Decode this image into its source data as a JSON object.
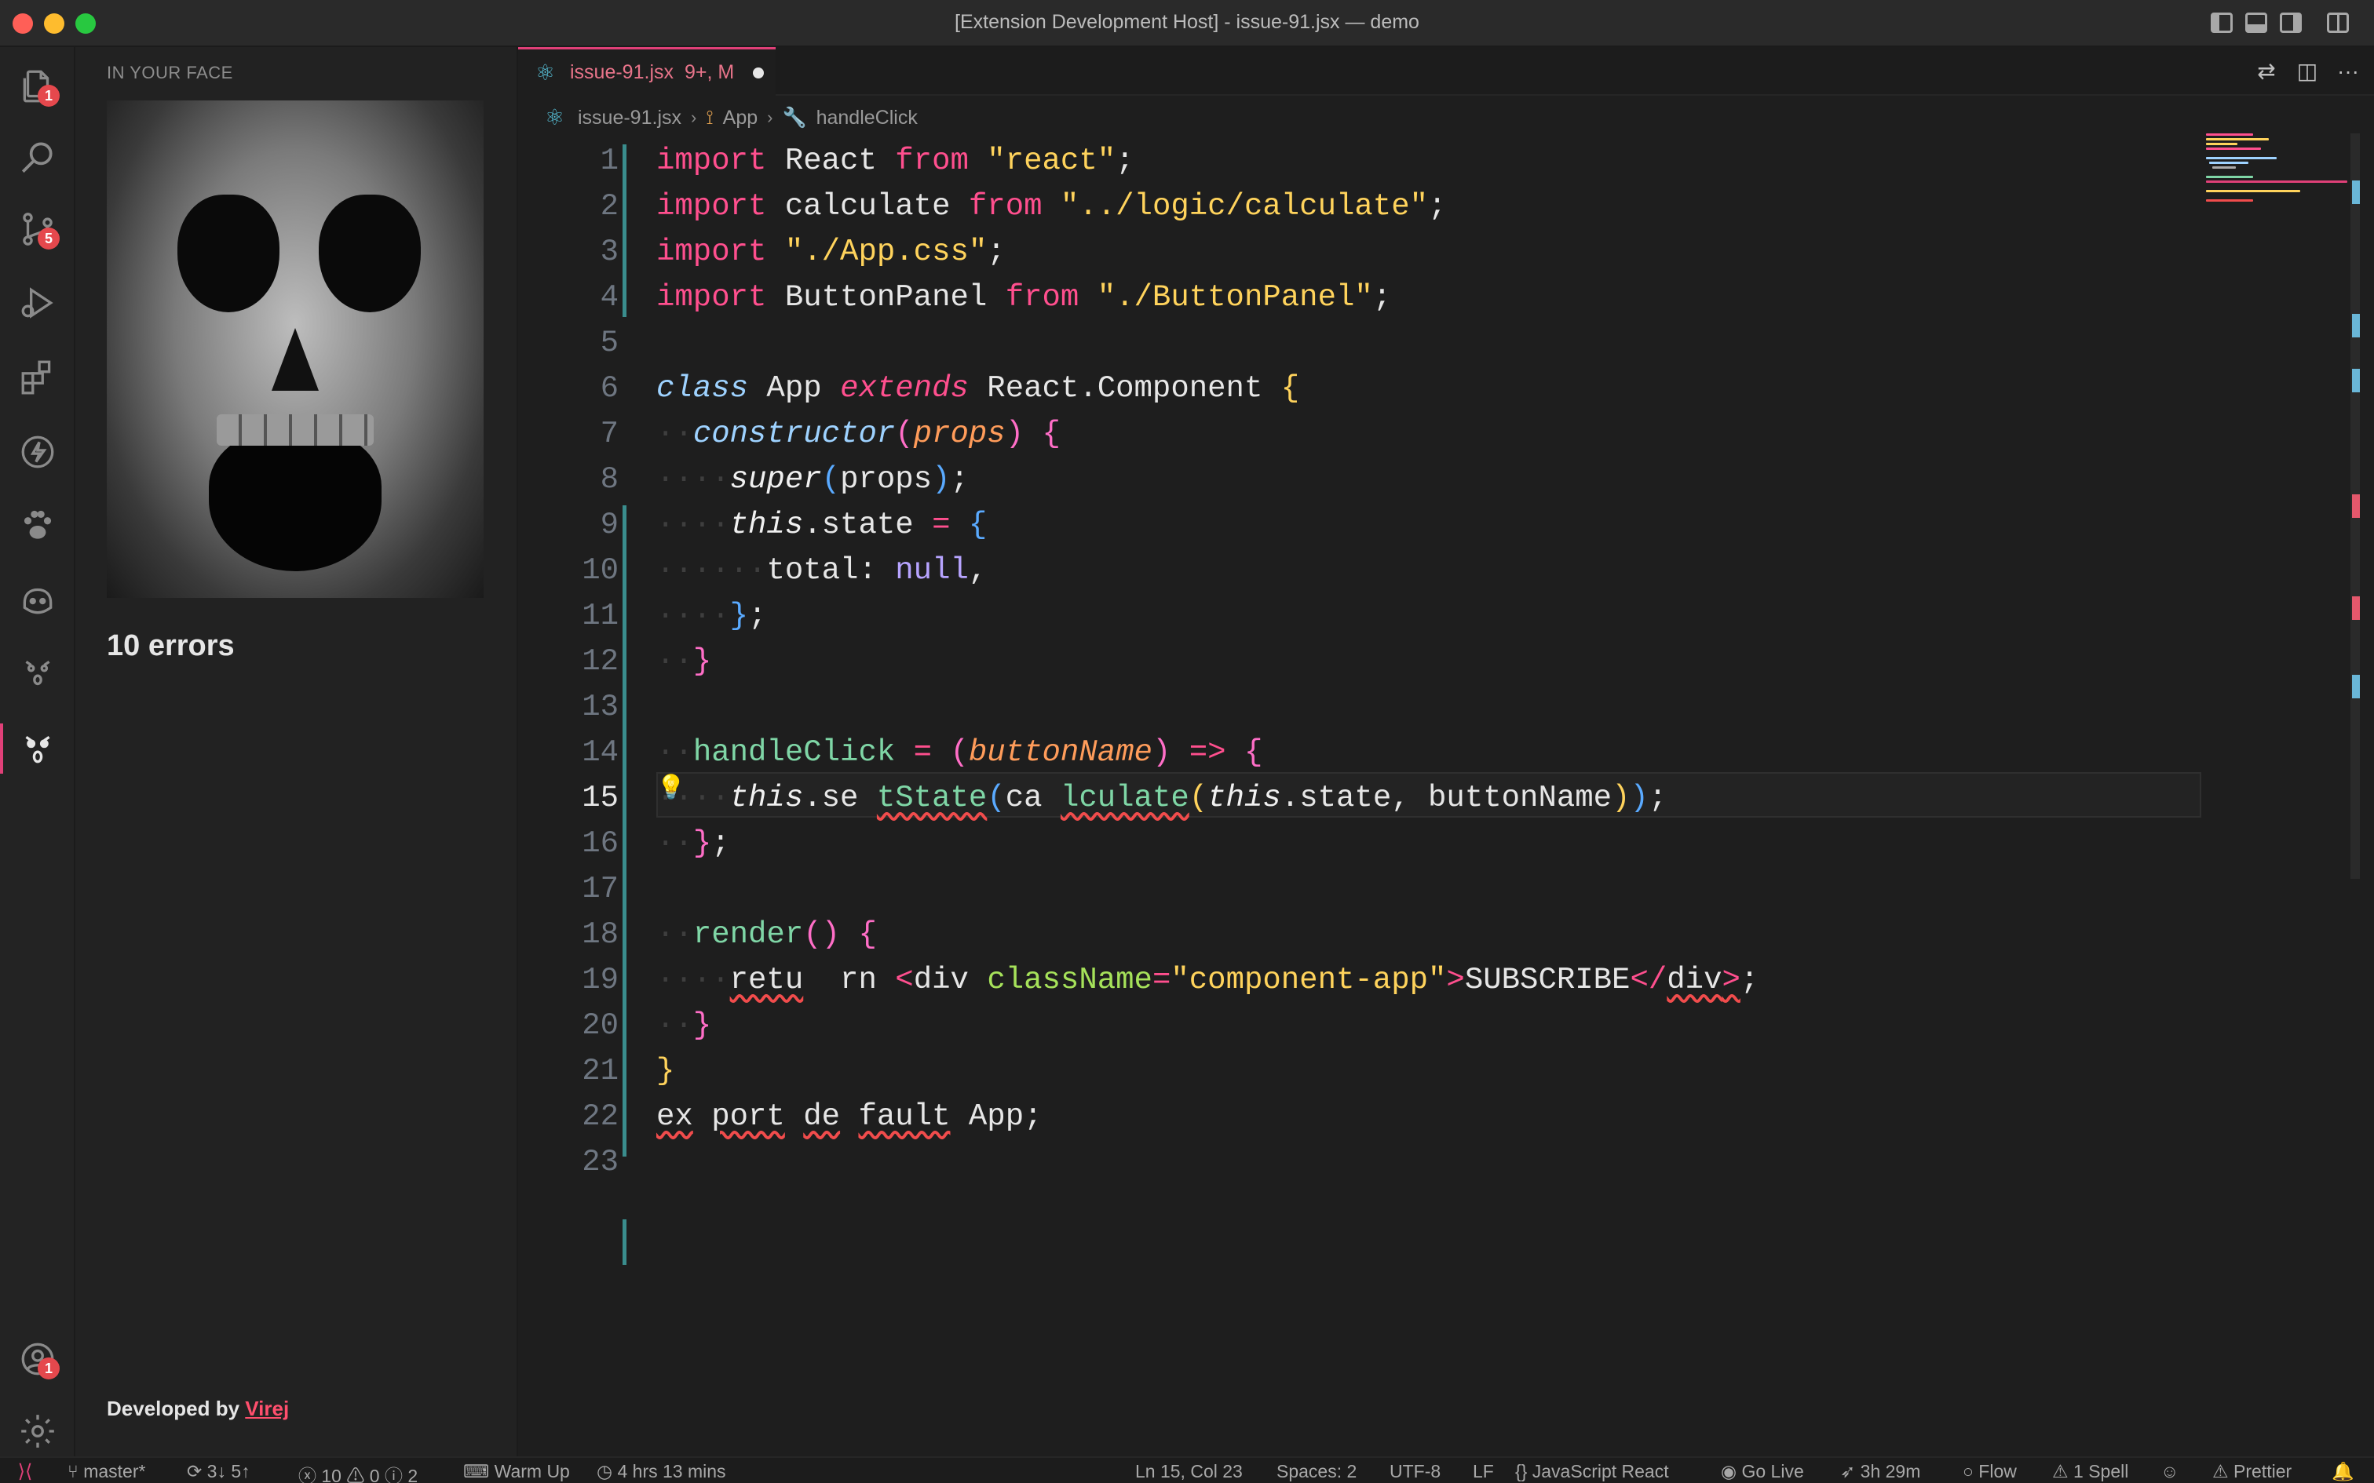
{
  "window": {
    "title": "[Extension Development Host] - issue-91.jsx — demo"
  },
  "activity_bar": {
    "explorer_badge": "1",
    "source_control_badge": "5",
    "accounts_badge": "1"
  },
  "side_panel": {
    "title": "IN YOUR FACE",
    "errors_text": "10 errors",
    "developed_by_prefix": "Developed by ",
    "developer_name": "Virej"
  },
  "tab": {
    "filename": "issue-91.jsx",
    "status": "9+, M"
  },
  "breadcrumb": {
    "file": "issue-91.jsx",
    "class": "App",
    "method": "handleClick"
  },
  "editor": {
    "line_numbers": [
      "1",
      "2",
      "3",
      "4",
      "5",
      "6",
      "7",
      "8",
      "9",
      "10",
      "11",
      "12",
      "13",
      "14",
      "15",
      "16",
      "17",
      "18",
      "19",
      "20",
      "21",
      "22",
      "23"
    ],
    "current_line": "15"
  },
  "status_bar": {
    "branch": "master*",
    "sync": "3↓ 5↑",
    "errors": "10",
    "warnings": "0",
    "infos": "2",
    "warm_up": "Warm Up",
    "time_tracked": "4 hrs 13 mins",
    "cursor_position": "Ln 15, Col 23",
    "indent": "Spaces: 2",
    "encoding": "UTF-8",
    "eol": "LF",
    "language": "JavaScript React",
    "go_live": "Go Live",
    "session_time": "3h 29m",
    "flow": "Flow",
    "spell": "1 Spell",
    "formatter": "Prettier"
  },
  "colors": {
    "accent": "#e04078",
    "error_badge": "#e5484d",
    "keyword": "#ff4f8e",
    "string": "#ffd35c",
    "function": "#7fd6a6"
  }
}
